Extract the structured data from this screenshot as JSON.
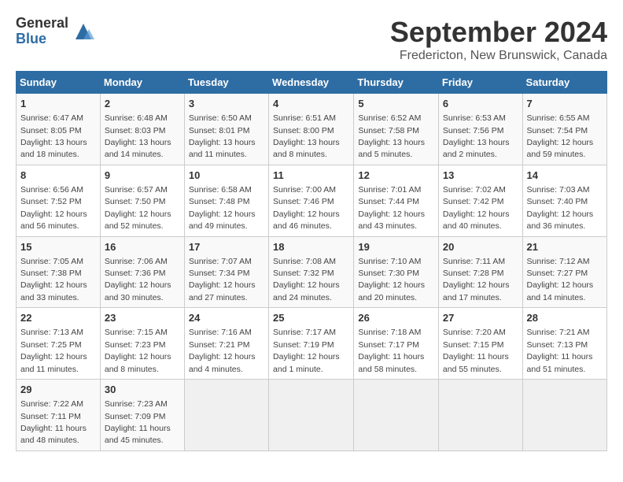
{
  "header": {
    "logo_general": "General",
    "logo_blue": "Blue",
    "month_title": "September 2024",
    "location": "Fredericton, New Brunswick, Canada"
  },
  "days_of_week": [
    "Sunday",
    "Monday",
    "Tuesday",
    "Wednesday",
    "Thursday",
    "Friday",
    "Saturday"
  ],
  "weeks": [
    [
      {
        "day": "1",
        "sunrise": "6:47 AM",
        "sunset": "8:05 PM",
        "daylight": "13 hours and 18 minutes."
      },
      {
        "day": "2",
        "sunrise": "6:48 AM",
        "sunset": "8:03 PM",
        "daylight": "13 hours and 14 minutes."
      },
      {
        "day": "3",
        "sunrise": "6:50 AM",
        "sunset": "8:01 PM",
        "daylight": "13 hours and 11 minutes."
      },
      {
        "day": "4",
        "sunrise": "6:51 AM",
        "sunset": "8:00 PM",
        "daylight": "13 hours and 8 minutes."
      },
      {
        "day": "5",
        "sunrise": "6:52 AM",
        "sunset": "7:58 PM",
        "daylight": "13 hours and 5 minutes."
      },
      {
        "day": "6",
        "sunrise": "6:53 AM",
        "sunset": "7:56 PM",
        "daylight": "13 hours and 2 minutes."
      },
      {
        "day": "7",
        "sunrise": "6:55 AM",
        "sunset": "7:54 PM",
        "daylight": "12 hours and 59 minutes."
      }
    ],
    [
      {
        "day": "8",
        "sunrise": "6:56 AM",
        "sunset": "7:52 PM",
        "daylight": "12 hours and 56 minutes."
      },
      {
        "day": "9",
        "sunrise": "6:57 AM",
        "sunset": "7:50 PM",
        "daylight": "12 hours and 52 minutes."
      },
      {
        "day": "10",
        "sunrise": "6:58 AM",
        "sunset": "7:48 PM",
        "daylight": "12 hours and 49 minutes."
      },
      {
        "day": "11",
        "sunrise": "7:00 AM",
        "sunset": "7:46 PM",
        "daylight": "12 hours and 46 minutes."
      },
      {
        "day": "12",
        "sunrise": "7:01 AM",
        "sunset": "7:44 PM",
        "daylight": "12 hours and 43 minutes."
      },
      {
        "day": "13",
        "sunrise": "7:02 AM",
        "sunset": "7:42 PM",
        "daylight": "12 hours and 40 minutes."
      },
      {
        "day": "14",
        "sunrise": "7:03 AM",
        "sunset": "7:40 PM",
        "daylight": "12 hours and 36 minutes."
      }
    ],
    [
      {
        "day": "15",
        "sunrise": "7:05 AM",
        "sunset": "7:38 PM",
        "daylight": "12 hours and 33 minutes."
      },
      {
        "day": "16",
        "sunrise": "7:06 AM",
        "sunset": "7:36 PM",
        "daylight": "12 hours and 30 minutes."
      },
      {
        "day": "17",
        "sunrise": "7:07 AM",
        "sunset": "7:34 PM",
        "daylight": "12 hours and 27 minutes."
      },
      {
        "day": "18",
        "sunrise": "7:08 AM",
        "sunset": "7:32 PM",
        "daylight": "12 hours and 24 minutes."
      },
      {
        "day": "19",
        "sunrise": "7:10 AM",
        "sunset": "7:30 PM",
        "daylight": "12 hours and 20 minutes."
      },
      {
        "day": "20",
        "sunrise": "7:11 AM",
        "sunset": "7:28 PM",
        "daylight": "12 hours and 17 minutes."
      },
      {
        "day": "21",
        "sunrise": "7:12 AM",
        "sunset": "7:27 PM",
        "daylight": "12 hours and 14 minutes."
      }
    ],
    [
      {
        "day": "22",
        "sunrise": "7:13 AM",
        "sunset": "7:25 PM",
        "daylight": "12 hours and 11 minutes."
      },
      {
        "day": "23",
        "sunrise": "7:15 AM",
        "sunset": "7:23 PM",
        "daylight": "12 hours and 8 minutes."
      },
      {
        "day": "24",
        "sunrise": "7:16 AM",
        "sunset": "7:21 PM",
        "daylight": "12 hours and 4 minutes."
      },
      {
        "day": "25",
        "sunrise": "7:17 AM",
        "sunset": "7:19 PM",
        "daylight": "12 hours and 1 minute."
      },
      {
        "day": "26",
        "sunrise": "7:18 AM",
        "sunset": "7:17 PM",
        "daylight": "11 hours and 58 minutes."
      },
      {
        "day": "27",
        "sunrise": "7:20 AM",
        "sunset": "7:15 PM",
        "daylight": "11 hours and 55 minutes."
      },
      {
        "day": "28",
        "sunrise": "7:21 AM",
        "sunset": "7:13 PM",
        "daylight": "11 hours and 51 minutes."
      }
    ],
    [
      {
        "day": "29",
        "sunrise": "7:22 AM",
        "sunset": "7:11 PM",
        "daylight": "11 hours and 48 minutes."
      },
      {
        "day": "30",
        "sunrise": "7:23 AM",
        "sunset": "7:09 PM",
        "daylight": "11 hours and 45 minutes."
      },
      null,
      null,
      null,
      null,
      null
    ]
  ]
}
